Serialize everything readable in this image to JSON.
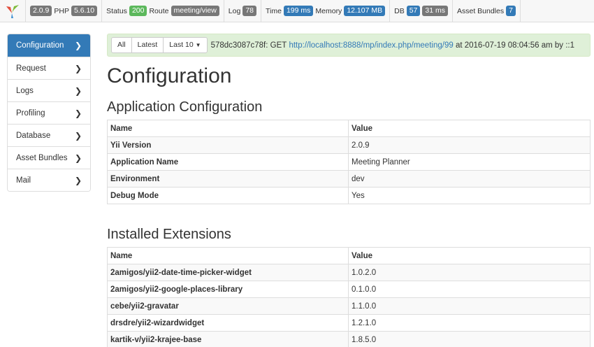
{
  "toolbar": {
    "yii_version": "2.0.9",
    "php_label": "PHP",
    "php_version": "5.6.10",
    "status_label": "Status",
    "status_code": "200",
    "route_label": "Route",
    "route_value": "meeting/view",
    "log_label": "Log",
    "log_count": "78",
    "time_label": "Time",
    "time_value": "199 ms",
    "memory_label": "Memory",
    "memory_value": "12.107 MB",
    "db_label": "DB",
    "db_count": "57",
    "db_time": "31 ms",
    "asset_label": "Asset Bundles",
    "asset_count": "7"
  },
  "sidebar": {
    "items": [
      {
        "label": "Configuration",
        "active": true
      },
      {
        "label": "Request"
      },
      {
        "label": "Logs"
      },
      {
        "label": "Profiling"
      },
      {
        "label": "Database"
      },
      {
        "label": "Asset Bundles"
      },
      {
        "label": "Mail"
      }
    ]
  },
  "infobar": {
    "btn_all": "All",
    "btn_latest": "Latest",
    "btn_last10": "Last 10",
    "tag_text": "578dc3087c78f: GET",
    "url": "http://localhost:8888/mp/index.php/meeting/99",
    "suffix": "at 2016-07-19 08:04:56 am by ::1"
  },
  "page": {
    "title": "Configuration",
    "app_config_heading": "Application Configuration",
    "extensions_heading": "Installed Extensions"
  },
  "app_config": {
    "headers": [
      "Name",
      "Value"
    ],
    "rows": [
      [
        "Yii Version",
        "2.0.9"
      ],
      [
        "Application Name",
        "Meeting Planner"
      ],
      [
        "Environment",
        "dev"
      ],
      [
        "Debug Mode",
        "Yes"
      ]
    ]
  },
  "extensions": {
    "headers": [
      "Name",
      "Value"
    ],
    "rows": [
      [
        "2amigos/yii2-date-time-picker-widget",
        "1.0.2.0"
      ],
      [
        "2amigos/yii2-google-places-library",
        "0.1.0.0"
      ],
      [
        "cebe/yii2-gravatar",
        "1.1.0.0"
      ],
      [
        "drsdre/yii2-wizardwidget",
        "1.2.1.0"
      ],
      [
        "kartik-v/yii2-krajee-base",
        "1.8.5.0"
      ]
    ]
  },
  "colors": {
    "active": "#337ab7",
    "success_bg": "#dff0d8",
    "badge_green": "#5cb85c",
    "badge_blue": "#337ab7",
    "badge_gray": "#777777"
  }
}
